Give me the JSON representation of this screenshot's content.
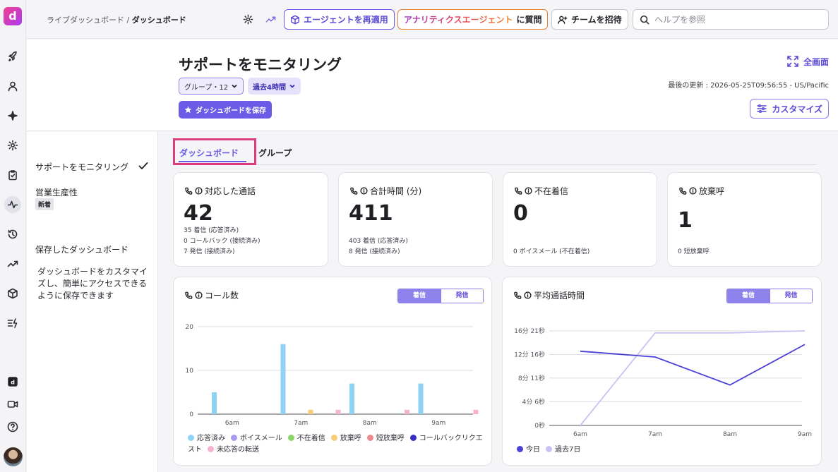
{
  "header": {
    "breadcrumb_parent": "ライブダッシュボード",
    "breadcrumb_sep": " / ",
    "breadcrumb_current": "ダッシュボード",
    "reapply_agent": "エージェントを再適用",
    "ask_agent_name": "アナリティクスエージェント",
    "ask_suffix": "に質問",
    "invite_team": "チームを招待",
    "search_placeholder": "ヘルプを参照"
  },
  "page": {
    "title": "サポートをモニタリング",
    "group_chip": "グループ・12",
    "time_chip": "過去4時間",
    "save_dashboard": "ダッシュボードを保存",
    "fullscreen": "全画面",
    "last_updated": "最後の更新 : 2026-05-25T09:56:55 - US/Pacific",
    "customize": "カスタマイズ"
  },
  "sidebar": {
    "monitor_support": "サポートをモニタリング",
    "sales_productivity": "営業生産性",
    "new_badge": "新着",
    "saved_dashboards": "保存したダッシュボード",
    "saved_description": "ダッシュボードをカスタマイズし、簡単にアクセスできるように保存できます"
  },
  "tabs": {
    "dashboard": "ダッシュボード",
    "group": "グループ"
  },
  "metrics": [
    {
      "title": "対応した通話",
      "value": "42",
      "details": [
        "35 着信 (応答済み)",
        "0 コールバック (接続済み)",
        "7 発信 (接続済み)"
      ]
    },
    {
      "title": "合計時間 (分)",
      "value": "411",
      "details": [
        "403 着信 (応答済み)",
        "8 発信 (接続済み)"
      ]
    },
    {
      "title": "不在着信",
      "value": "0",
      "details": [
        "0 ボイスメール (不在着信)"
      ]
    },
    {
      "title": "放棄呼",
      "value": "1",
      "details": [
        "0 短放棄呼"
      ]
    }
  ],
  "call_count_card": {
    "title": "コール数",
    "seg_on": "着信",
    "seg_off": "発信"
  },
  "avg_time_card": {
    "title": "平均通話時間",
    "seg_on": "着信",
    "seg_off": "発信"
  },
  "colors": {
    "accent": "#6b5ce7",
    "highlight": "#dd3d7e"
  },
  "chart_data": [
    {
      "type": "bar",
      "title": "コール数",
      "categories": [
        "6am",
        "7am",
        "8am",
        "9am"
      ],
      "yticks": [
        "0",
        "10",
        "20"
      ],
      "ylim": [
        0,
        20
      ],
      "series": [
        {
          "name": "応答済み",
          "color": "#8fd3f4",
          "values": [
            5,
            16,
            7,
            7
          ]
        },
        {
          "name": "ボイスメール",
          "color": "#a99cf0",
          "values": [
            0,
            0,
            0,
            0
          ]
        },
        {
          "name": "不在着信",
          "color": "#8bd46a",
          "values": [
            0,
            0,
            0,
            0
          ]
        },
        {
          "name": "放棄呼",
          "color": "#f6cd78",
          "values": [
            0,
            1,
            0,
            0
          ]
        },
        {
          "name": "短放棄呼",
          "color": "#f08a8a",
          "values": [
            0,
            0,
            0,
            0
          ]
        },
        {
          "name": "コールバックリクエスト",
          "color": "#3a2fc4",
          "values": [
            0,
            0,
            0,
            0
          ]
        },
        {
          "name": "未応答の転送",
          "color": "#f6b3cf",
          "values": [
            0,
            1,
            1,
            1
          ]
        }
      ]
    },
    {
      "type": "line",
      "title": "平均通話時間",
      "categories": [
        "6am",
        "7am",
        "8am",
        "9am"
      ],
      "yticks": [
        "0秒",
        "4分 6秒",
        "8分 11秒",
        "12分 16秒",
        "16分 21秒"
      ],
      "ytick_seconds": [
        0,
        246,
        491,
        736,
        981
      ],
      "series": [
        {
          "name": "今日",
          "color": "#4a3fd6",
          "values_seconds": [
            770,
            710,
            420,
            840
          ]
        },
        {
          "name": "過去7日",
          "color": "#c9c2f4",
          "values_seconds": [
            0,
            960,
            960,
            981
          ]
        }
      ]
    }
  ]
}
